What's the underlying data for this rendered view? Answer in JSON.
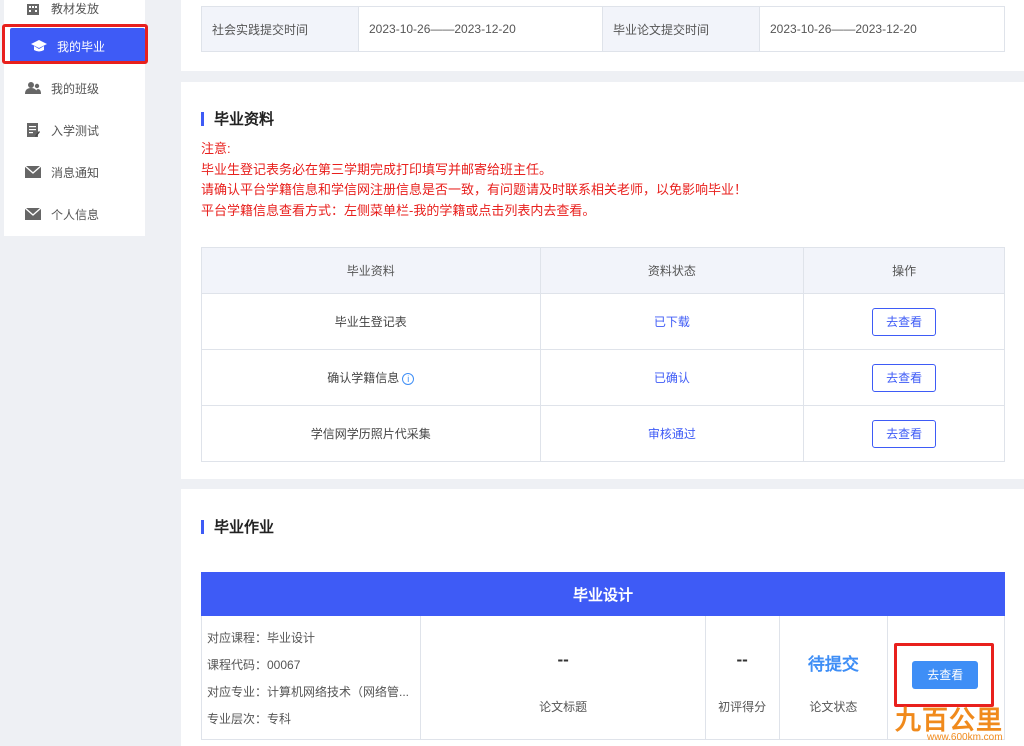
{
  "sidebar": {
    "items": [
      {
        "label": "教材发放",
        "icon": "building-icon"
      },
      {
        "label": "我的毕业",
        "icon": "graduation-cap-icon",
        "active": true
      },
      {
        "label": "我的班级",
        "icon": "users-icon"
      },
      {
        "label": "入学测试",
        "icon": "edit-document-icon"
      },
      {
        "label": "消息通知",
        "icon": "mail-icon"
      },
      {
        "label": "个人信息",
        "icon": "mail-icon"
      }
    ]
  },
  "schedule": {
    "social_label": "社会实践提交时间",
    "social_value": "2023-10-26——2023-12-20",
    "thesis_label": "毕业论文提交时间",
    "thesis_value": "2023-10-26——2023-12-20"
  },
  "materials": {
    "title": "毕业资料",
    "notes": [
      "注意:",
      "毕业生登记表务必在第三学期完成打印填写并邮寄给班主任。",
      "请确认平台学籍信息和学信网注册信息是否一致，有问题请及时联系相关老师，以免影响毕业！",
      "平台学籍信息查看方式：左侧菜单栏-我的学籍或点击列表内去查看。"
    ],
    "headers": [
      "毕业资料",
      "资料状态",
      "操作"
    ],
    "rows": [
      {
        "name": "毕业生登记表",
        "status": "已下载",
        "action": "去查看"
      },
      {
        "name": "确认学籍信息",
        "status": "已确认",
        "action": "去查看"
      },
      {
        "name": "学信网学历照片代采集",
        "status": "审核通过",
        "action": "去查看"
      }
    ],
    "info_glyph": "i"
  },
  "homework": {
    "title": "毕业作业",
    "card_title": "毕业设计",
    "info": [
      "对应课程：毕业设计",
      "课程代码：00067",
      "对应专业：计算机网络技术（网络管...",
      "专业层次：专科"
    ],
    "thesis_value": "--",
    "thesis_label": "论文标题",
    "score_value": "--",
    "score_label": "初评得分",
    "status_value": "待提交",
    "status_label": "论文状态",
    "action": "去查看"
  },
  "watermark": {
    "logo": "九百公里",
    "url": "www.600km.com"
  },
  "colors": {
    "accent": "#3e5bf6",
    "link": "#3e8ef6",
    "warning": "#e8201d",
    "highlight_box": "#e8201d"
  }
}
